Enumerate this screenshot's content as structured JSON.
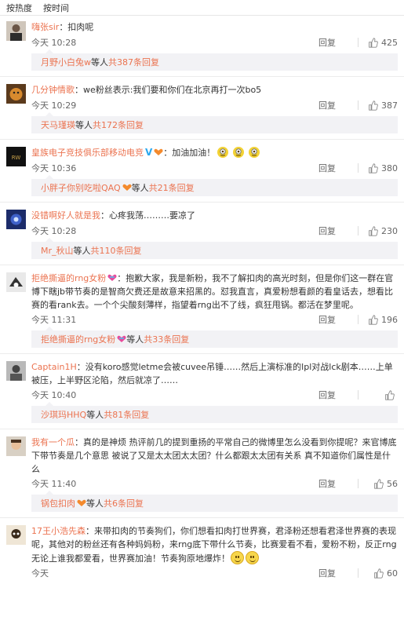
{
  "sort": {
    "hot": "按热度",
    "time": "按时间"
  },
  "actions": {
    "reply": "回复"
  },
  "comments": [
    {
      "user": "嗨张sir",
      "text": "：扣肉呢",
      "time": "今天 10:28",
      "likes": "425",
      "reply": {
        "name": "月野小白兔w",
        "mid": " 等人 ",
        "more": "共387条回复"
      }
    },
    {
      "user": "几分钟情歌",
      "text": "：we粉丝表示:我们要和你们在北京再打一次bo5",
      "time": "今天 10:29",
      "likes": "387",
      "reply": {
        "name": "天马瑾瑛",
        "mid": " 等人 ",
        "more": "共172条回复"
      }
    },
    {
      "user": "皇族电子竞技俱乐部移动电竞",
      "text": "：加油加油！",
      "time": "今天 10:36",
      "likes": "380",
      "reply": {
        "name": "小胖子你别吃啦QAQ",
        "mid": " 等人 ",
        "more": "共21条回复"
      }
    },
    {
      "user": "没错啊好人就是我",
      "text": "：心疼我荡………要凉了",
      "time": "今天 10:28",
      "likes": "230",
      "reply": {
        "name": "Mr_秋山",
        "mid": " 等人 ",
        "more": "共110条回复"
      }
    },
    {
      "user": "拒绝撕逼的rng女粉",
      "text": "：抱歉大家，我是新粉，我不了解扣肉的高光时刻，但是你们这一群在官博下瞎jb带节奏的是智商欠费还是故意来招黑的。怼我直言，真爱粉想看颜的看皇话去，想看比赛的看rank去。一个个尖酸刻薄样，指望着rng出不了线，疯狂甩锅。都活在梦里呢。",
      "time": "今天 11:31",
      "likes": "196",
      "reply": {
        "name": "拒绝撕逼的rng女粉",
        "mid": " 等人 ",
        "more": "共33条回复"
      }
    },
    {
      "user": "Captain1H",
      "text": "：没有koro感觉letme会被cuvee吊锤……然后上演标准的lpl对战lck剧本……上单被压，上半野区沦陷，然后就凉了……",
      "time": "今天 10:40",
      "likes": "",
      "reply": {
        "name": "沙琪玛HHQ",
        "mid": " 等人 ",
        "more": "共81条回复"
      }
    },
    {
      "user": "我有一个瓜",
      "text": "：真的是神烦 热评前几的提到重扬的平常自己的微博里怎么没看到你提呢？来官博底下带节奏是几个意思 被说了又是太太团太太团？什么都跟太太团有关系 真不知道你们属性是什么",
      "time": "今天 11:40",
      "likes": "56",
      "reply": {
        "name": "锅包扣肉",
        "mid": " 等人 ",
        "more": "共6条回复"
      }
    },
    {
      "user": "17王小浩先森",
      "text": "：来带扣肉的节奏狗们，你们想看扣肉打世界赛，君泽粉还想看君泽世界赛的表现呢，其他对的粉丝还有各种妈妈粉，来rng底下带什么节奏，比赛爱看不看，爱粉不粉，反正rng无论上谁我都爱看，世界赛加油！节奏狗原地爆炸！",
      "time": "今天",
      "likes": "60"
    }
  ],
  "colors": {
    "link": "#eb7350",
    "replyBg": "#f2f2f5",
    "text": "#333333"
  }
}
